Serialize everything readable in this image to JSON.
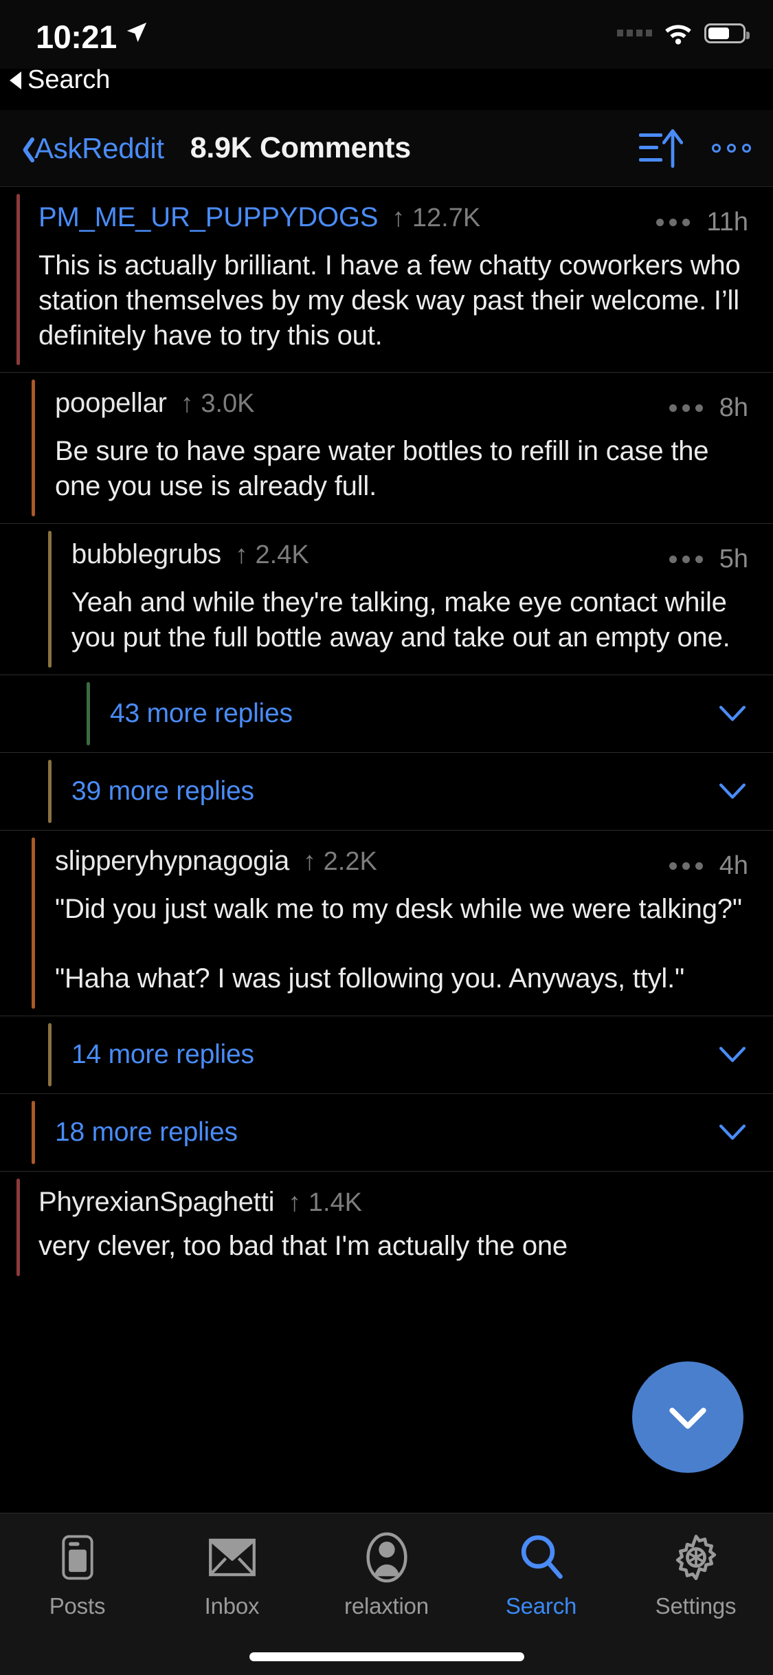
{
  "status_bar": {
    "time": "10:21",
    "location_icon": "location-arrow-icon",
    "signal_icon": "cellular-dots-icon",
    "wifi_icon": "wifi-icon",
    "battery_icon": "battery-icon"
  },
  "back_to_app": {
    "label": "Search",
    "icon": "back-triangle-icon"
  },
  "nav": {
    "back_label": "AskReddit",
    "back_icon": "chevron-left-icon",
    "title": "8.9K Comments",
    "sort_icon": "sort-ascending-icon",
    "overflow_icon": "more-horizontal-icon"
  },
  "colors": {
    "accent": "#4a8cf7",
    "background": "#000000",
    "fab": "#4a7fce",
    "depth0_bar": "#8c3a3a",
    "depth1_bar": "#a85a28",
    "depth2_bar": "#8a7240",
    "depth3_bar": "#3d6b42"
  },
  "comments": [
    {
      "type": "comment",
      "author": "PM_ME_UR_PUPPYDOGS",
      "author_style": "op",
      "score": "12.7K",
      "score_arrow": "↑",
      "age": "11h",
      "depth": 0,
      "body": "This is actually brilliant. I have a few chatty coworkers who station themselves by my desk way past their welcome. I’ll definitely have to try this out."
    },
    {
      "type": "comment",
      "author": "poopellar",
      "author_style": "norm",
      "score": "3.0K",
      "score_arrow": "↑",
      "age": "8h",
      "depth": 1,
      "body": "Be sure to have spare water bottles to refill in case the one you use is already full."
    },
    {
      "type": "comment",
      "author": "bubblegrubs",
      "author_style": "norm",
      "score": "2.4K",
      "score_arrow": "↑",
      "age": "5h",
      "depth": 2,
      "body": "Yeah and while they're talking, make eye contact while you put the full bottle away and take out an empty one."
    },
    {
      "type": "more",
      "label": "43 more replies",
      "depth": 3,
      "chevron_icon": "chevron-down-icon"
    },
    {
      "type": "more",
      "label": "39 more replies",
      "depth": 2,
      "chevron_icon": "chevron-down-icon"
    },
    {
      "type": "comment",
      "author": "slipperyhypnagogia",
      "author_style": "norm",
      "score": "2.2K",
      "score_arrow": "↑",
      "age": "4h",
      "depth": 1,
      "body": "\"Did you just walk me to my desk while we were talking?\"\n\n\"Haha what? I was just following you. Anyways, ttyl.\""
    },
    {
      "type": "more",
      "label": "14 more replies",
      "depth": 2,
      "chevron_icon": "chevron-down-icon"
    },
    {
      "type": "more",
      "label": "18 more replies",
      "depth": 1,
      "chevron_icon": "chevron-down-icon"
    },
    {
      "type": "comment",
      "author": "PhyrexianSpaghetti",
      "author_style": "norm",
      "score": "1.4K",
      "score_arrow": "↑",
      "age": "",
      "depth": 0,
      "body": "very clever, too bad that I'm actually the one"
    }
  ],
  "fab": {
    "icon": "chevron-down-icon"
  },
  "tabs": [
    {
      "label": "Posts",
      "icon": "posts-icon",
      "active": false
    },
    {
      "label": "Inbox",
      "icon": "envelope-icon",
      "active": false
    },
    {
      "label": "relaxtion",
      "icon": "account-icon",
      "active": false
    },
    {
      "label": "Search",
      "icon": "search-icon",
      "active": true
    },
    {
      "label": "Settings",
      "icon": "gear-icon",
      "active": false
    }
  ]
}
